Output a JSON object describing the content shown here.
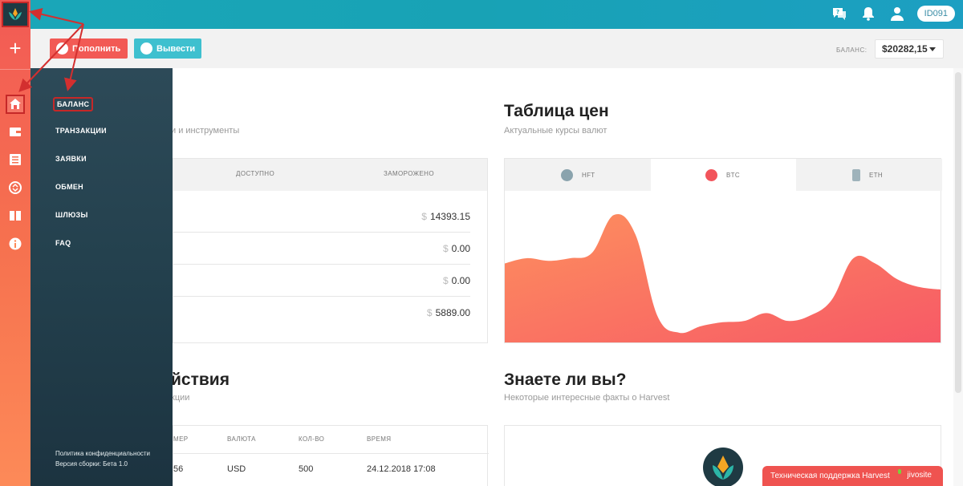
{
  "header": {
    "user_id": "ID091",
    "icons": [
      "support-chat-icon",
      "bell-icon",
      "user-icon"
    ]
  },
  "rail": {
    "icons": [
      "logo-icon",
      "plus-icon",
      "home-icon",
      "wallet-icon",
      "list-icon",
      "exchange-icon",
      "gateway-icon",
      "info-icon"
    ]
  },
  "sidemenu": {
    "items": [
      "БАЛАНС",
      "ТРАНЗАКЦИИ",
      "ЗАЯВКИ",
      "ОБМЕН",
      "ШЛЮЗЫ",
      "FAQ"
    ],
    "privacy": "Политика конфиденциальности",
    "version": "Версия сборки: Бета 1.0"
  },
  "actions": {
    "deposit": "Пополнить",
    "withdraw": "Вывести"
  },
  "balance": {
    "label": "БАЛАНС:",
    "value": "$20282,15"
  },
  "balance_section": {
    "subtitle_partial": "и и инструменты",
    "headers": [
      "ДОСТУПНО",
      "ЗАМОРОЖЕНО"
    ],
    "rows": [
      {
        "currency": "$",
        "amount": "14393.15"
      },
      {
        "currency": "$",
        "amount": "0.00"
      },
      {
        "currency": "$",
        "amount": "0.00"
      },
      {
        "currency": "$",
        "amount": "5889.00"
      }
    ]
  },
  "prices": {
    "title": "Таблица цен",
    "subtitle": "Актуальные курсы валют",
    "tabs": [
      "HFT",
      "BTC",
      "ETH"
    ],
    "active_tab": "BTC",
    "colors": {
      "area_top": "#fd8f5e",
      "area_bottom": "#f75a66"
    }
  },
  "chart_data": {
    "type": "area",
    "x": [
      0,
      1,
      2,
      3,
      4,
      5,
      6,
      7,
      8,
      9,
      10,
      11,
      12,
      13,
      14,
      15,
      16,
      17,
      18,
      19,
      20
    ],
    "values": [
      58,
      62,
      60,
      62,
      66,
      95,
      80,
      18,
      5,
      10,
      13,
      14,
      20,
      14,
      18,
      30,
      62,
      58,
      46,
      40,
      38
    ],
    "xlabel": "",
    "ylabel": "",
    "ylim": [
      0,
      100
    ]
  },
  "actions_section": {
    "title_partial": "йствия",
    "subtitle_partial": "кции",
    "headers": [
      "МЕР",
      "ВАЛЮТА",
      "КОЛ-ВО",
      "ВРЕМЯ"
    ],
    "row": [
      "56",
      "USD",
      "500",
      "24.12.2018 17:08"
    ]
  },
  "facts": {
    "title": "Знаете ли вы?",
    "subtitle": "Некоторые интересные факты о Harvest"
  },
  "support": {
    "label": "Техническая поддержка Harvest",
    "brand": "jivosite"
  }
}
